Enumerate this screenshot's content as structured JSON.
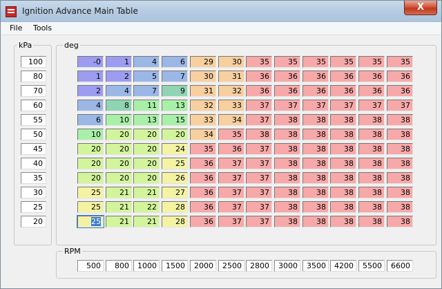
{
  "window": {
    "title": "Ignition Advance Main Table",
    "close_label": "X"
  },
  "menu": [
    "File",
    "Tools"
  ],
  "kpa": {
    "label": "kPa",
    "values": [
      100,
      80,
      70,
      60,
      55,
      50,
      45,
      40,
      35,
      30,
      25,
      20
    ]
  },
  "deg": {
    "label": "deg",
    "rows": [
      [
        0,
        1,
        4,
        6,
        29,
        30,
        35,
        35,
        35,
        35,
        35,
        35
      ],
      [
        1,
        2,
        5,
        7,
        30,
        31,
        36,
        36,
        36,
        36,
        36,
        36
      ],
      [
        2,
        4,
        7,
        9,
        31,
        32,
        36,
        36,
        36,
        36,
        36,
        36
      ],
      [
        4,
        8,
        11,
        13,
        32,
        33,
        37,
        37,
        37,
        37,
        37,
        37
      ],
      [
        6,
        10,
        13,
        15,
        33,
        34,
        37,
        38,
        38,
        38,
        38,
        38
      ],
      [
        10,
        20,
        20,
        20,
        34,
        35,
        38,
        38,
        38,
        38,
        38,
        38
      ],
      [
        20,
        20,
        20,
        24,
        35,
        36,
        37,
        38,
        38,
        38,
        38,
        38
      ],
      [
        20,
        20,
        20,
        25,
        36,
        37,
        37,
        38,
        38,
        38,
        38,
        38
      ],
      [
        20,
        20,
        20,
        26,
        36,
        37,
        37,
        38,
        38,
        38,
        38,
        38
      ],
      [
        25,
        21,
        21,
        27,
        36,
        37,
        37,
        38,
        38,
        38,
        38,
        38
      ],
      [
        25,
        21,
        22,
        28,
        36,
        37,
        37,
        38,
        38,
        38,
        38,
        38
      ],
      [
        25,
        21,
        21,
        28,
        36,
        37,
        37,
        38,
        38,
        38,
        38,
        38
      ]
    ],
    "selected_cell": {
      "row": 11,
      "col": 0
    }
  },
  "rpm": {
    "label": "RPM",
    "values": [
      500,
      800,
      1000,
      1500,
      2000,
      2500,
      2800,
      3000,
      3500,
      4200,
      5500,
      6600
    ]
  },
  "colors": {
    "titlebar": "#b7cde3",
    "window_bg": "#f0f0f0",
    "selection": "#3a7bd5"
  }
}
